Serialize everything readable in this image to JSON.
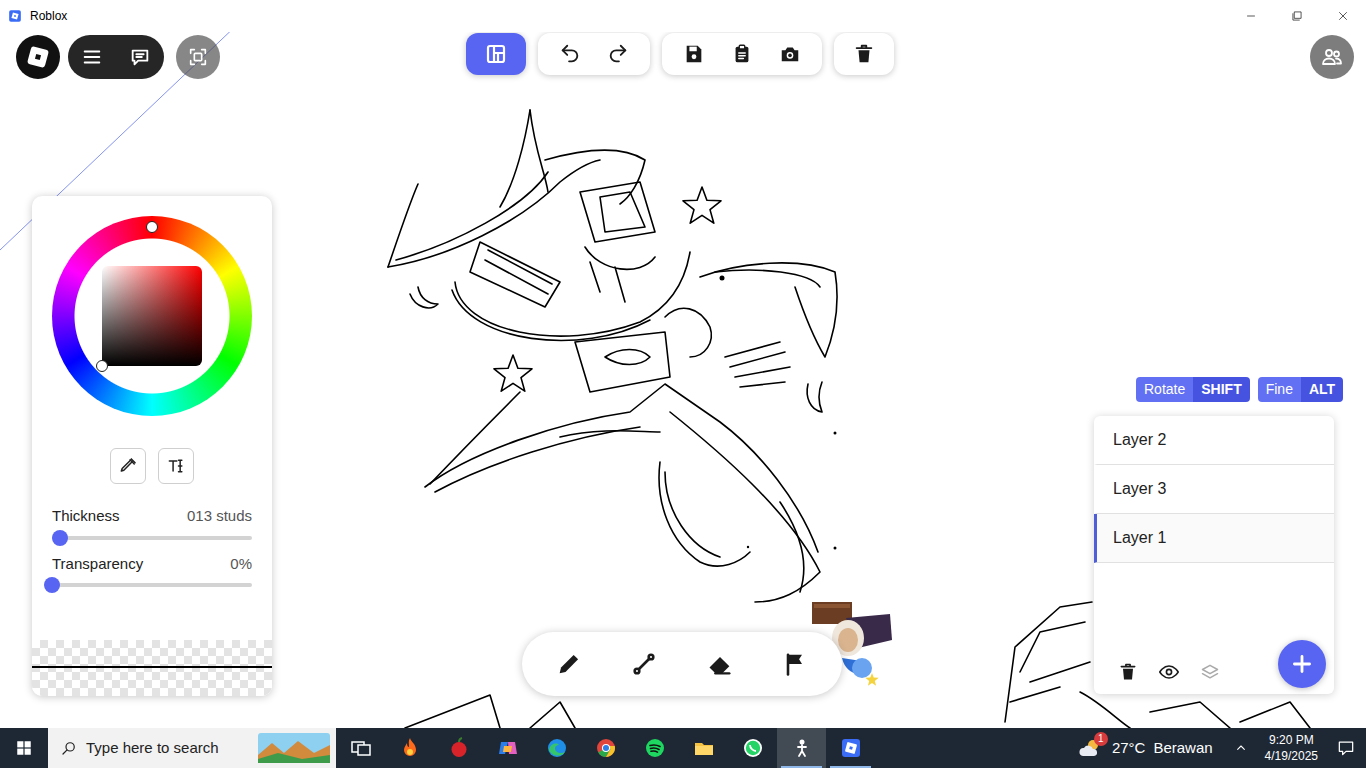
{
  "window": {
    "title": "Roblox"
  },
  "top_toolbar": {
    "mode_selected": true
  },
  "color_picker": {
    "hue_level": 0,
    "saturation_level": 0,
    "brightness_level": 0
  },
  "thickness": {
    "label": "Thickness",
    "reading": "013 studs",
    "level": 0.04
  },
  "transparency": {
    "label": "Transparency",
    "reading": "0%",
    "level": 0
  },
  "shortcuts": [
    {
      "label": "Rotate",
      "key": "SHIFT"
    },
    {
      "label": "Fine",
      "key": "ALT"
    }
  ],
  "layers": [
    {
      "label": "Layer 2",
      "selected": false
    },
    {
      "label": "Layer 3",
      "selected": false
    },
    {
      "label": "Layer 1",
      "selected": true
    }
  ],
  "taskbar": {
    "search_placeholder": "Type here to search",
    "apps": [
      {
        "kind": "task-view",
        "running": false,
        "focused": false
      },
      {
        "kind": "flame",
        "running": false,
        "focused": false
      },
      {
        "kind": "apple",
        "running": false,
        "focused": false
      },
      {
        "kind": "copilot",
        "running": false,
        "focused": false
      },
      {
        "kind": "edge",
        "running": false,
        "focused": false
      },
      {
        "kind": "chrome",
        "running": false,
        "focused": false
      },
      {
        "kind": "spotify",
        "running": false,
        "focused": false
      },
      {
        "kind": "files",
        "running": false,
        "focused": false
      },
      {
        "kind": "whatsapp",
        "running": false,
        "focused": false
      },
      {
        "kind": "roblox-player",
        "running": true,
        "focused": true
      },
      {
        "kind": "roblox-studio",
        "running": true,
        "focused": false
      }
    ],
    "weather": {
      "badge": "1",
      "temperature": "27°C",
      "condition": "Berawan"
    },
    "time": "9:20 PM",
    "date": "4/19/2025"
  }
}
